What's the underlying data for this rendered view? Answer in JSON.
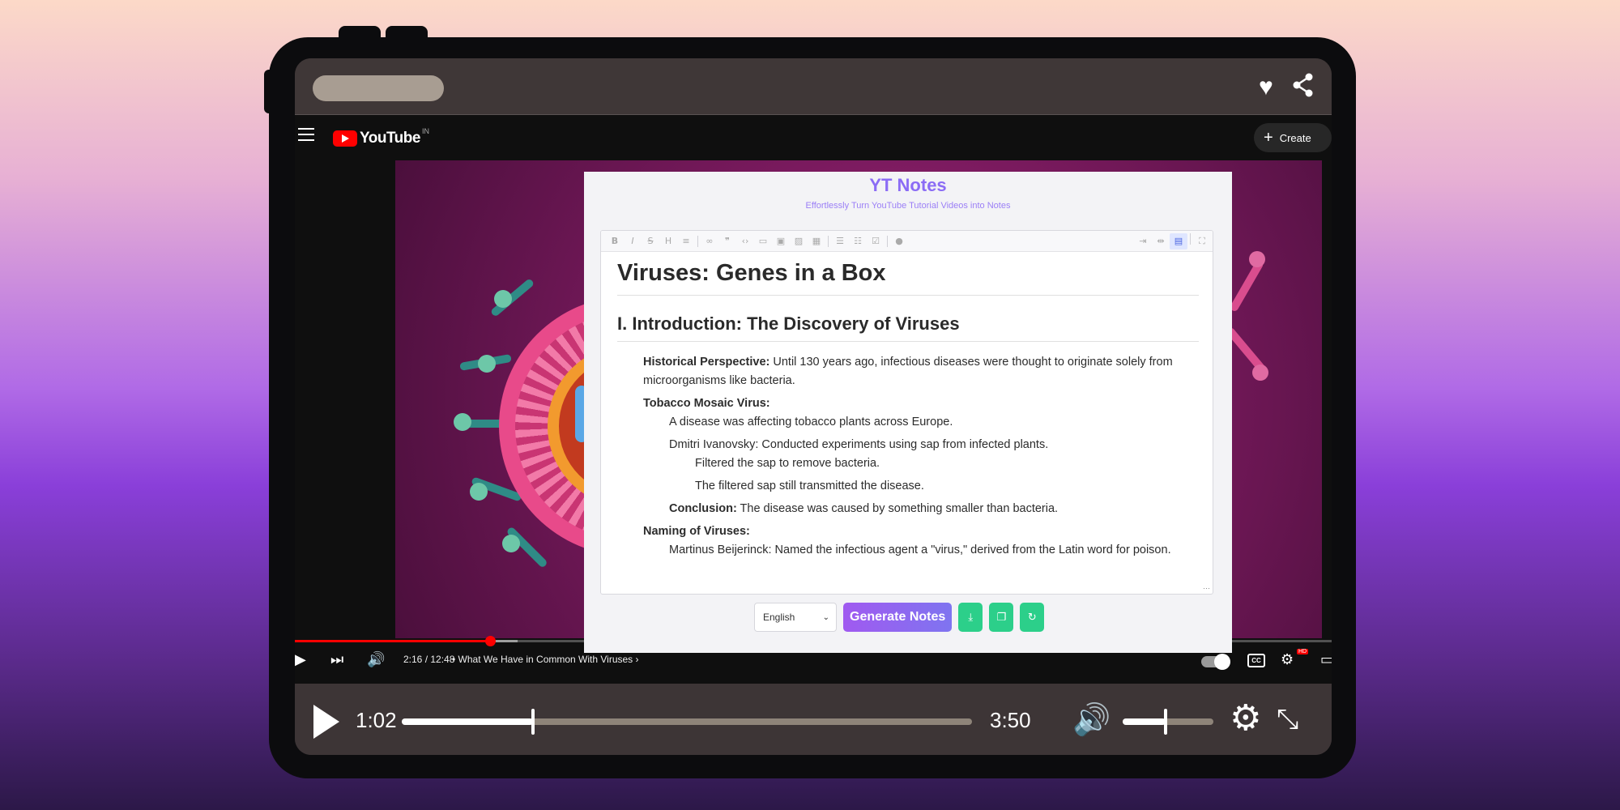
{
  "device_top": {
    "icons": [
      "heart-icon",
      "share-icon"
    ]
  },
  "youtube": {
    "logo_text": "YouTube",
    "country_code": "IN",
    "create_label": "Create",
    "player": {
      "time": "2:16 / 12:48",
      "separator": "•",
      "chapter": "What We Have in Common With Viruses",
      "chapter_arrow": "›",
      "cc_label": "CC",
      "hd_badge": "HD",
      "progress_fraction": 0.188,
      "buffer_fraction": 0.215
    }
  },
  "notes_app": {
    "title": "YT Notes",
    "subtitle": "Effortlessly Turn YouTube Tutorial Videos into Notes",
    "document": {
      "h1": "Viruses: Genes in a Box",
      "h2": "I. Introduction: The Discovery of Viruses",
      "items": {
        "historical_label": "Historical Perspective:",
        "historical_text": " Until 130 years ago, infectious diseases were thought to originate solely from microorganisms like bacteria.",
        "tobacco_label": "Tobacco Mosaic Virus:",
        "tobacco_1": "A disease was affecting tobacco plants across Europe.",
        "tobacco_2": "Dmitri Ivanovsky: Conducted experiments using sap from infected plants.",
        "tobacco_2a": "Filtered the sap to remove bacteria.",
        "tobacco_2b": "The filtered sap still transmitted the disease.",
        "conclusion_label": "Conclusion:",
        "conclusion_text": " The disease was caused by something smaller than bacteria.",
        "naming_label": "Naming of Viruses:",
        "naming_1": "Martinus Beijerinck: Named the infectious agent a \"virus,\" derived from the Latin word for poison."
      }
    },
    "language_select": "English",
    "generate_label": "Generate Notes",
    "icon_buttons": [
      "download-icon",
      "copy-icon",
      "refresh-icon"
    ]
  },
  "device_player": {
    "current_time": "1:02",
    "duration": "3:50",
    "progress_fraction": 0.23,
    "volume_fraction": 0.47
  }
}
